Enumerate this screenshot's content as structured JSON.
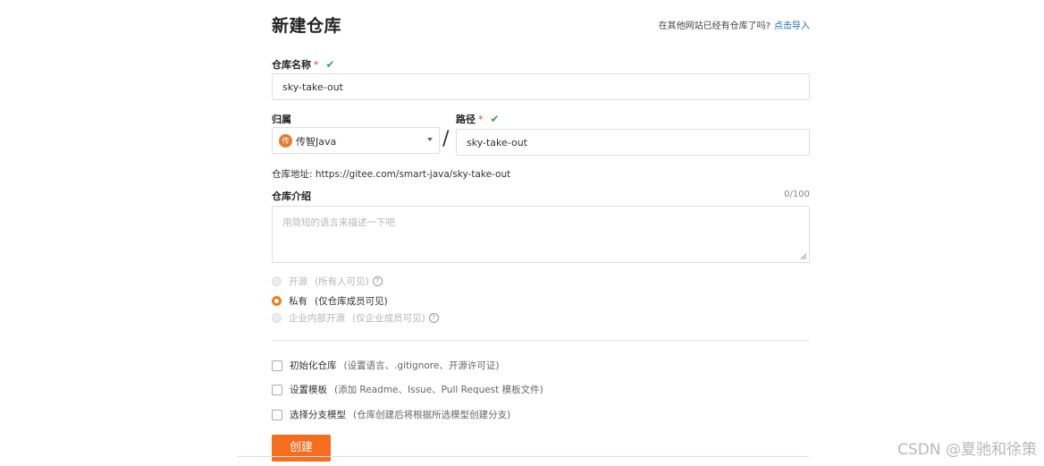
{
  "header": {
    "title": "新建仓库",
    "import_hint": "在其他网站已经有仓库了吗?",
    "import_link": "点击导入"
  },
  "repo_name": {
    "label": "仓库名称",
    "required_mark": "*",
    "valid_mark": "✔",
    "value": "sky-take-out"
  },
  "owner": {
    "label": "归属",
    "avatar_text": "传",
    "value": "传智Java"
  },
  "path": {
    "separator": "/",
    "label": "路径",
    "required_mark": "*",
    "valid_mark": "✔",
    "value": "sky-take-out"
  },
  "repo_url": {
    "label": "仓库地址:",
    "value": "https://gitee.com/smart-java/sky-take-out"
  },
  "description": {
    "label": "仓库介绍",
    "counter": "0/100",
    "placeholder": "用简短的语言来描述一下吧"
  },
  "visibility": {
    "options": [
      {
        "label": "开源",
        "desc": "(所有人可见)",
        "selected": false,
        "disabled": true,
        "help": "?"
      },
      {
        "label": "私有",
        "desc": "(仅仓库成员可见)",
        "selected": true,
        "disabled": false,
        "help": ""
      },
      {
        "label": "企业内部开源",
        "desc": "(仅企业成员可见)",
        "selected": false,
        "disabled": true,
        "help": "?"
      }
    ]
  },
  "options": [
    {
      "label": "初始化仓库",
      "desc": "(设置语言、.gitignore、开源许可证)",
      "checked": false
    },
    {
      "label": "设置模板",
      "desc": "(添加 Readme、Issue、Pull Request 模板文件)",
      "checked": false
    },
    {
      "label": "选择分支模型",
      "desc": "(仓库创建后将根据所选模型创建分支)",
      "checked": false
    }
  ],
  "submit": {
    "label": "创建"
  },
  "watermark": "CSDN @夏驰和徐策",
  "colors": {
    "accent": "#f56d1d",
    "link": "#1e6fb5",
    "valid": "#2fa84f",
    "required": "#e03b3b"
  }
}
